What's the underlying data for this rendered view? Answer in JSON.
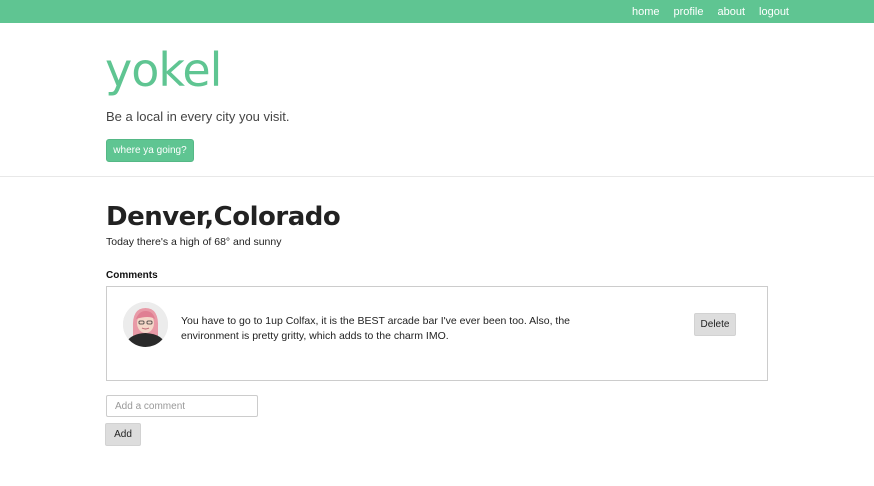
{
  "nav": {
    "items": [
      {
        "label": "home"
      },
      {
        "label": "profile"
      },
      {
        "label": "about"
      },
      {
        "label": "logout"
      }
    ]
  },
  "hero": {
    "brand": "yokel",
    "tagline": "Be a local in every city you visit.",
    "cta_label": "where ya going?"
  },
  "city": {
    "title": "Denver,Colorado",
    "weather": "Today there's a high of 68° and sunny"
  },
  "comments": {
    "heading": "Comments",
    "items": [
      {
        "text": "You have to go to 1up Colfax, it is the BEST arcade bar I've ever been too. Also, the environment is pretty gritty, which adds to the charm IMO.",
        "delete_label": "Delete"
      }
    ],
    "input_placeholder": "Add a comment",
    "input_value": "",
    "add_label": "Add"
  },
  "colors": {
    "brand_green": "#5fc592",
    "button_gray": "#dddddd"
  }
}
